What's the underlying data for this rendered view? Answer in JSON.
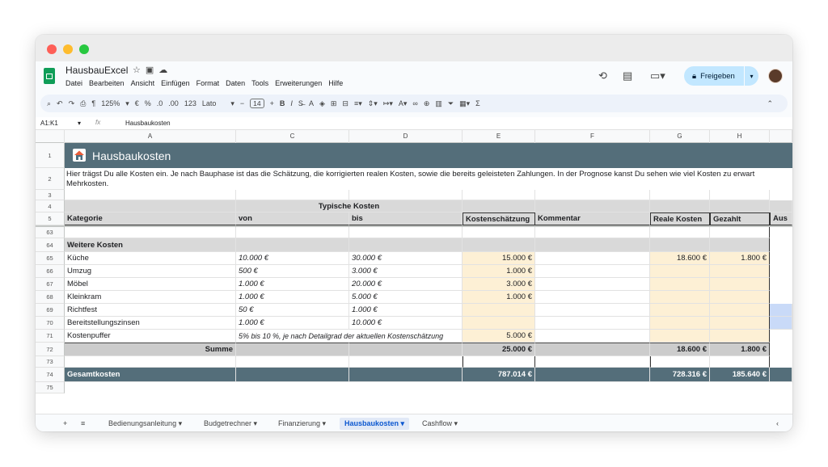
{
  "doc": {
    "title": "HausbauExcel"
  },
  "menu": [
    "Datei",
    "Bearbeiten",
    "Ansicht",
    "Einfügen",
    "Format",
    "Daten",
    "Tools",
    "Erweiterungen",
    "Hilfe"
  ],
  "share_label": "Freigeben",
  "toolbar": {
    "zoom": "125%",
    "currency": "€",
    "percent": "%",
    "dec_less": ".0",
    "dec_more": ".00",
    "numfmt": "123",
    "font": "Lato",
    "size": "14"
  },
  "formula": {
    "name_box": "A1:K1",
    "fx": "fx",
    "value": "Hausbaukosten"
  },
  "columns": [
    "A",
    "C",
    "D",
    "E",
    "F",
    "G",
    "H"
  ],
  "banner": {
    "title": "Hausbaukosten"
  },
  "intro": {
    "line1": "Hier trägst Du alle Kosten ein. Je nach Bauphase ist das die Schätzung, die korrigierten realen Kosten, sowie die bereits geleisteten Zahlungen. In der Prognose kanst Du sehen wie viel Kosten zu erwart",
    "line2": "Mehrkosten."
  },
  "table_head": {
    "typische": "Typische Kosten",
    "kategorie": "Kategorie",
    "von": "von",
    "bis": "bis",
    "schaetzung": "Kostenschätzung",
    "kommentar": "Kommentar",
    "real": "Reale Kosten",
    "gezahlt": "Gezahlt",
    "aus": "Aus"
  },
  "row_numbers": {
    "r1": "1",
    "r2": "2",
    "r3": "3",
    "r4": "4",
    "r5": "5",
    "r63": "63",
    "r64": "64",
    "r65": "65",
    "r66": "66",
    "r67": "67",
    "r68": "68",
    "r69": "69",
    "r70": "70",
    "r71": "71",
    "r72": "72",
    "r73": "73",
    "r74": "74",
    "r75": "75"
  },
  "section": "Weitere Kosten",
  "rows": [
    {
      "kat": "Küche",
      "von": "10.000 €",
      "bis": "30.000 €",
      "est": "15.000 €",
      "real": "18.600 €",
      "paid": "1.800 €"
    },
    {
      "kat": "Umzug",
      "von": "500 €",
      "bis": "3.000 €",
      "est": "1.000 €",
      "real": "",
      "paid": ""
    },
    {
      "kat": "Möbel",
      "von": "1.000 €",
      "bis": "20.000 €",
      "est": "3.000 €",
      "real": "",
      "paid": ""
    },
    {
      "kat": "Kleinkram",
      "von": "1.000 €",
      "bis": "5.000 €",
      "est": "1.000 €",
      "real": "",
      "paid": ""
    },
    {
      "kat": "Richtfest",
      "von": "50 €",
      "bis": "1.000 €",
      "est": "",
      "real": "",
      "paid": ""
    },
    {
      "kat": "Bereitstellungszinsen",
      "von": "1.000 €",
      "bis": "10.000 €",
      "est": "",
      "real": "",
      "paid": ""
    },
    {
      "kat": "Kostenpuffer",
      "von": "5% bis 10 %, je nach Detailgrad der aktuellen Kostenschätzung",
      "bis": "",
      "est": "5.000 €",
      "real": "",
      "paid": ""
    }
  ],
  "summe": {
    "label": "Summe",
    "est": "25.000 €",
    "real": "18.600 €",
    "paid": "1.800 €"
  },
  "gesamt": {
    "label": "Gesamtkosten",
    "est": "787.014 €",
    "real": "728.316 €",
    "paid": "185.640 €"
  },
  "tabs": [
    "Bedienungsanleitung",
    "Budgetrechner",
    "Finanzierung",
    "Hausbaukosten",
    "Cashflow"
  ],
  "colors": {
    "banner": "#546e7a",
    "yellow": "#fdf0d5",
    "grey": "#d9d9d9",
    "share": "#c2e7ff"
  }
}
